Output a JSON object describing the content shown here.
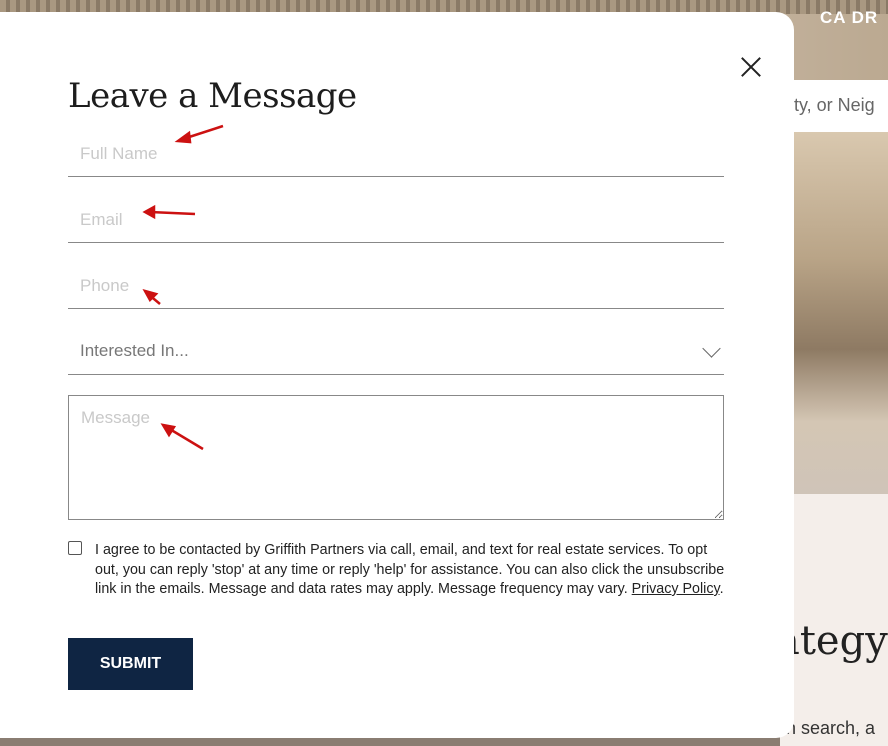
{
  "background": {
    "title": "CA DR",
    "search_fragment": "ity, or Neig",
    "heading_fragment": "ategy",
    "subtext_fragment": "en search, a"
  },
  "modal": {
    "title": "Leave a Message",
    "fields": {
      "full_name": {
        "placeholder": "Full Name",
        "value": ""
      },
      "email": {
        "placeholder": "Email",
        "value": ""
      },
      "phone": {
        "placeholder": "Phone",
        "value": ""
      },
      "interested_in": {
        "selected": "Interested In..."
      },
      "message": {
        "placeholder": "Message",
        "value": ""
      }
    },
    "consent": {
      "checked": false,
      "text": "I agree to be contacted by Griffith Partners via call, email, and text for real estate services. To opt out, you can reply 'stop' at any time or reply 'help' for assistance. You can also click the unsubscribe link in the emails. Message and data rates may apply. Message frequency may vary.",
      "link_text": "Privacy Policy",
      "suffix": "."
    },
    "submit_label": "SUBMIT"
  },
  "icons": [
    "close-icon",
    "chevron-down-icon",
    "resize-grip-icon",
    "checkbox-icon"
  ],
  "colors": {
    "submit_bg": "#0f2543",
    "annotation_arrow": "#cc1111"
  }
}
